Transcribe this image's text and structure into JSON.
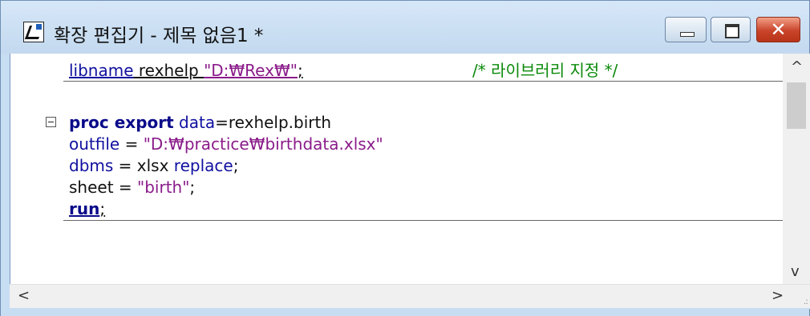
{
  "window": {
    "title": "확장 편집기 - 제목 없음1 *",
    "buttons": {
      "minimize": "minimize",
      "maximize": "maximize",
      "close": "✕"
    }
  },
  "code": {
    "line1": {
      "keyword": "libname",
      "rest": " rexhelp ",
      "string": "\"D:₩Rex₩\"",
      "end": ";",
      "comment": "/* 라이브러리 지정 */"
    },
    "line3": {
      "proc": "proc",
      "export": " export",
      "data_kw": " data",
      "rest": "=rexhelp.birth"
    },
    "line4": {
      "kw": "outfile",
      "eq": " = ",
      "string": "\"D:₩practice₩birthdata.xlsx\""
    },
    "line5": {
      "kw": "dbms",
      "rest": " = xlsx ",
      "replace": "replace",
      "end": ";"
    },
    "line6": {
      "rest": "sheet = ",
      "string": "\"birth\"",
      "end": ";"
    },
    "line7": {
      "run": "run",
      "end": ";"
    }
  },
  "icons": [
    "app-icon",
    "fold-minus-icon",
    "scroll-up-icon",
    "scroll-down-icon",
    "scroll-left-icon",
    "scroll-right-icon",
    "resize-grip-icon"
  ],
  "colors": {
    "titlebar": "#c7ddf2",
    "keyword": "#1010a0",
    "string": "#8a1b8a",
    "comment": "#0a8a0a",
    "close": "#c9442a"
  }
}
